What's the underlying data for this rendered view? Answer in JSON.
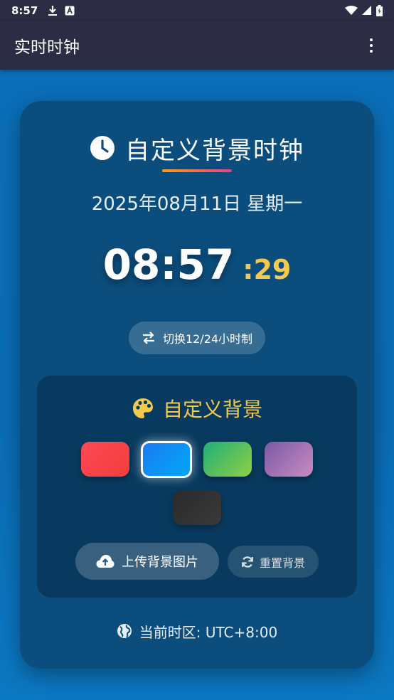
{
  "status_bar": {
    "time": "8:57",
    "icons": [
      "download-icon",
      "app-a-icon",
      "wifi-icon",
      "signal-icon",
      "battery-icon"
    ]
  },
  "app_bar": {
    "title": "实时时钟",
    "menu_icon": "more-vert-icon"
  },
  "clock_card": {
    "title": "自定义背景时钟",
    "title_icon": "clock-icon",
    "date": "2025年08月11日 星期一",
    "time_hm": "08:57",
    "time_sec": ":29",
    "toggle_label": "切换12/24小时制",
    "toggle_icon": "swap-icon"
  },
  "background_panel": {
    "title": "自定义背景",
    "title_icon": "palette-icon",
    "swatches": [
      {
        "name": "red",
        "colors": [
          "#ff4a55",
          "#f23c3c"
        ],
        "selected": false
      },
      {
        "name": "blue",
        "colors": [
          "#1a7cf0",
          "#00a8f8"
        ],
        "selected": true
      },
      {
        "name": "green",
        "colors": [
          "#1fae7a",
          "#8fd043"
        ],
        "selected": false
      },
      {
        "name": "purple",
        "colors": [
          "#7b5aa6",
          "#c98bc0"
        ],
        "selected": false
      },
      {
        "name": "dark",
        "colors": [
          "#2a2a2a",
          "#3a3a3a"
        ],
        "selected": false
      }
    ],
    "upload_label": "上传背景图片",
    "upload_icon": "cloud-upload-icon",
    "reset_label": "重置背景",
    "reset_icon": "refresh-icon"
  },
  "timezone": {
    "label": "当前时区: UTC+8:00",
    "icon": "globe-icon"
  },
  "colors": {
    "accent_gold": "#f5c94c",
    "card_bg": "#0b4d7c",
    "appbar_bg": "#2c2c44"
  }
}
